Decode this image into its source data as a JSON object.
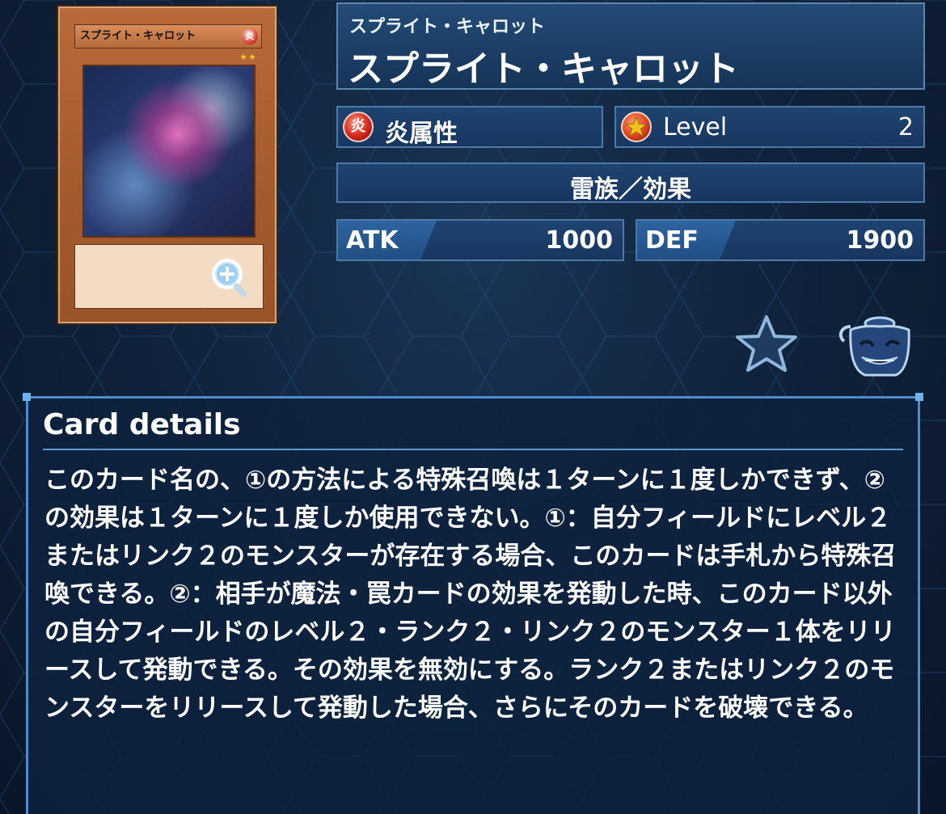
{
  "card": {
    "image_name": "スプライト・キャロット",
    "image_attribute_glyph": "炎",
    "image_stars": "★★"
  },
  "name": {
    "reading": "スプライト・キャロット",
    "title": "スプライト・キャロット"
  },
  "attribute": {
    "icon": "fire-attribute-icon",
    "icon_glyph": "炎",
    "label": "炎属性"
  },
  "level": {
    "icon": "level-star-icon",
    "label": "Level",
    "value": "2"
  },
  "type": {
    "label": "雷族／効果"
  },
  "atk": {
    "label": "ATK",
    "value": "1000"
  },
  "def": {
    "label": "DEF",
    "value": "1900"
  },
  "actions": {
    "favorite_icon": "star-icon",
    "deck_icon": "pot-of-greed-icon"
  },
  "details": {
    "title": "Card details",
    "text": "このカード名の、①の方法による特殊召喚は１ターンに１度しかできず、②の効果は１ターンに１度しか使用できない。①：自分フィールドにレベル２またはリンク２のモンスターが存在する場合、このカードは手札から特殊召喚できる。②：相手が魔法・罠カードの効果を発動した時、このカード以外の自分フィールドのレベル２・ランク２・リンク２のモンスター１体をリリースして発動できる。その効果を無効にする。ランク２またはリンク２のモンスターをリリースして発動した場合、さらにそのカードを破壊できる。"
  },
  "colors": {
    "background": "#10233d",
    "panel_border": "#4f8ccd",
    "fire": "#d2281d"
  }
}
